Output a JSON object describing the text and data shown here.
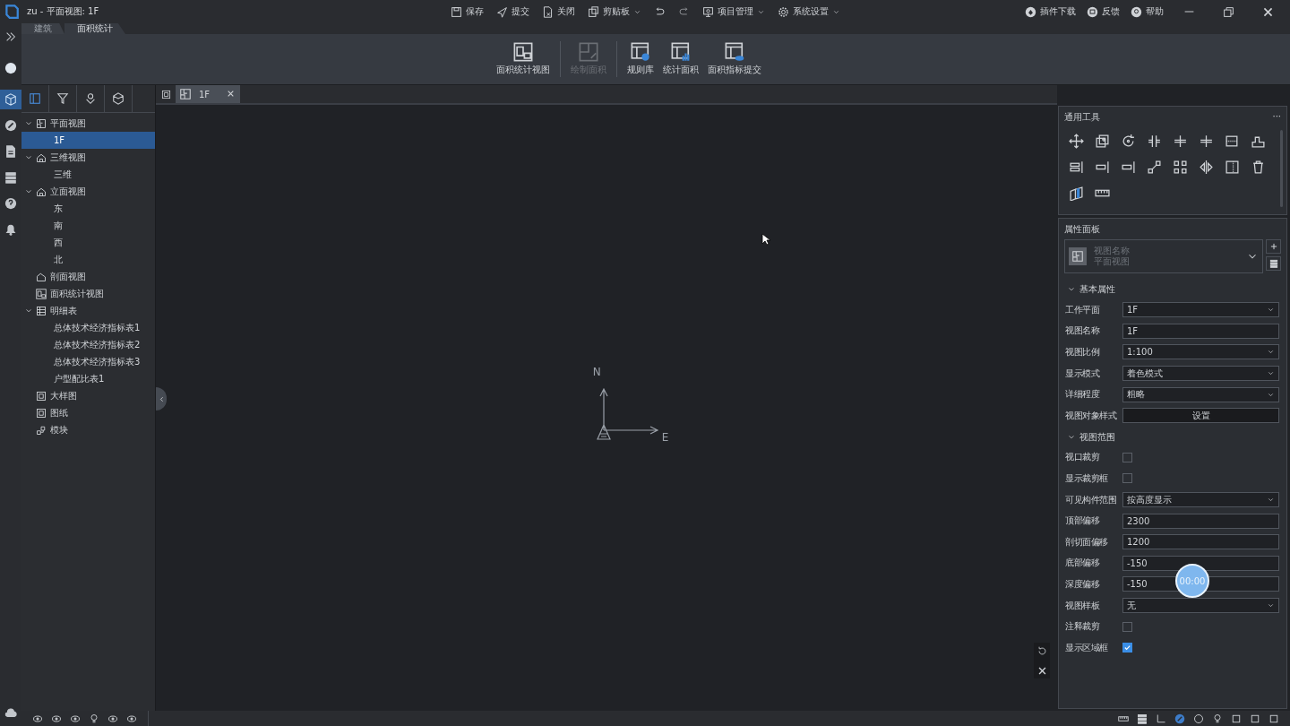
{
  "window": {
    "title": "zu - 平面视图: 1F"
  },
  "toolbar": {
    "left": [
      {
        "label": "保存",
        "dropdown": false
      },
      {
        "label": "提交",
        "dropdown": false
      },
      {
        "label": "关闭",
        "dropdown": false
      },
      {
        "label": "剪贴板",
        "dropdown": true
      }
    ],
    "right": [
      {
        "label": "项目管理",
        "dropdown": true
      },
      {
        "label": "系统设置",
        "dropdown": true
      }
    ]
  },
  "window_links": [
    {
      "label": "插件下载"
    },
    {
      "label": "反馈"
    },
    {
      "label": "帮助"
    }
  ],
  "ribbon_tabs": [
    {
      "label": "建筑",
      "selected": false
    },
    {
      "label": "面积统计",
      "selected": true
    }
  ],
  "ribbon_buttons": [
    {
      "label": "面积统计视图",
      "disabled": false,
      "separator_after": true
    },
    {
      "label": "绘制面积",
      "disabled": true,
      "separator_after": true
    },
    {
      "label": "规则库",
      "disabled": false,
      "separator_after": false
    },
    {
      "label": "统计面积",
      "disabled": false,
      "separator_after": false
    },
    {
      "label": "面积指标提交",
      "disabled": false,
      "separator_after": false
    }
  ],
  "tree_tools": [
    {
      "selected": true
    },
    {
      "selected": false
    },
    {
      "selected": false
    },
    {
      "selected": false
    }
  ],
  "tree": [
    {
      "label": "平面视图",
      "expanded": true,
      "selected": false,
      "children": [
        {
          "label": "1F",
          "selected": true
        }
      ]
    },
    {
      "label": "三维视图",
      "expanded": true,
      "selected": false,
      "children": [
        {
          "label": "三维",
          "selected": false
        }
      ]
    },
    {
      "label": "立面视图",
      "expanded": true,
      "selected": false,
      "children": [
        {
          "label": "东",
          "selected": false
        },
        {
          "label": "南",
          "selected": false
        },
        {
          "label": "西",
          "selected": false
        },
        {
          "label": "北",
          "selected": false
        }
      ]
    },
    {
      "label": "剖面视图",
      "selected": false
    },
    {
      "label": "面积统计视图",
      "selected": false
    },
    {
      "label": "明细表",
      "expanded": true,
      "selected": false,
      "children": [
        {
          "label": "总体技术经济指标表1",
          "selected": false
        },
        {
          "label": "总体技术经济指标表2",
          "selected": false
        },
        {
          "label": "总体技术经济指标表3",
          "selected": false
        },
        {
          "label": "户型配比表1",
          "selected": false
        }
      ]
    },
    {
      "label": "大样图",
      "selected": false
    },
    {
      "label": "图纸",
      "selected": false
    },
    {
      "label": "模块",
      "selected": false
    }
  ],
  "view_tabs": [
    {
      "label": "1F",
      "selected": true
    }
  ],
  "canvas": {
    "compass": {
      "north": "N",
      "east": "E"
    }
  },
  "general_tools": {
    "title": "通用工具",
    "menu": "···"
  },
  "properties": {
    "title": "属性面板",
    "type_selector": {
      "label": "视图名称",
      "value": "平面视图"
    },
    "sections": [
      {
        "title": "基本属性",
        "expanded": true,
        "rows": [
          {
            "label": "工作平面",
            "kind": "select",
            "value": "1F"
          },
          {
            "label": "视图名称",
            "kind": "text",
            "value": "1F"
          },
          {
            "label": "视图比例",
            "kind": "select",
            "value": "1:100"
          },
          {
            "label": "显示模式",
            "kind": "select",
            "value": "着色模式"
          },
          {
            "label": "详细程度",
            "kind": "select",
            "value": "粗略"
          },
          {
            "label": "视图对象样式",
            "kind": "button",
            "value": "设置"
          }
        ]
      },
      {
        "title": "视图范围",
        "expanded": true,
        "rows": [
          {
            "label": "视口裁剪",
            "kind": "checkbox",
            "checked": false
          },
          {
            "label": "显示裁剪框",
            "kind": "checkbox",
            "checked": false
          },
          {
            "label": "可见构件范围",
            "kind": "select",
            "value": "按高度显示"
          },
          {
            "label": "顶部偏移",
            "kind": "text",
            "value": "2300"
          },
          {
            "label": "剖切面偏移",
            "kind": "text",
            "value": "1200"
          },
          {
            "label": "底部偏移",
            "kind": "text",
            "value": "-150"
          },
          {
            "label": "深度偏移",
            "kind": "text",
            "value": "-150"
          },
          {
            "label": "视图样板",
            "kind": "select",
            "value": "无"
          },
          {
            "label": "注释裁剪",
            "kind": "checkbox",
            "checked": false
          },
          {
            "label": "显示区域框",
            "kind": "checkbox",
            "checked": true
          }
        ]
      }
    ]
  },
  "recorder_badge": "00:00"
}
